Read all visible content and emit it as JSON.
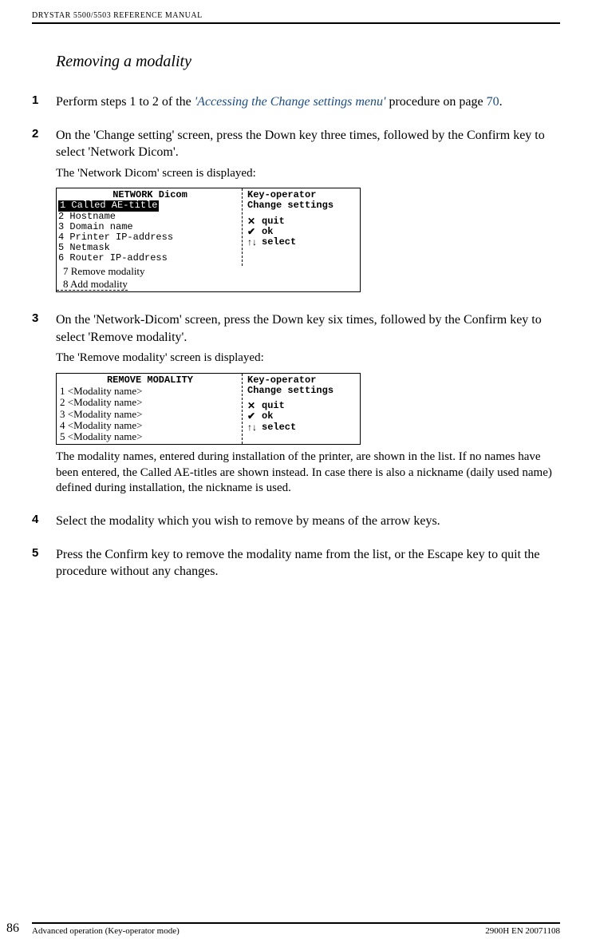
{
  "header": {
    "running": "DRYSTAR 5500/5503 REFERENCE MANUAL"
  },
  "title": "Removing a modality",
  "steps": {
    "s1": {
      "num": "1",
      "pre": "Perform steps 1 to 2 of the ",
      "link": "'Accessing the Change settings menu'",
      "mid": " procedure on page ",
      "pagenum": "70",
      "post": "."
    },
    "s2": {
      "num": "2",
      "text": "On the 'Change setting' screen, press the Down key three times, followed by the Confirm key to select 'Network Dicom'.",
      "sub": "The 'Network Dicom' screen is displayed:"
    },
    "s3": {
      "num": "3",
      "text": "On the 'Network-Dicom' screen, press the Down key six times, followed by the Confirm key to select 'Remove modality'.",
      "sub": "The 'Remove modality' screen is displayed:",
      "note": "The modality names, entered during installation of the printer, are shown in the list. If no names have been entered, the Called AE-titles are shown instead. In case there is also a nickname (daily used name) defined during installation, the nickname is used."
    },
    "s4": {
      "num": "4",
      "text": "Select the modality which you wish to remove by means of the arrow keys."
    },
    "s5": {
      "num": "5",
      "text": "Press the Confirm key to remove the modality name from the list, or the Escape key to quit the procedure without any changes."
    }
  },
  "screen1": {
    "title": "NETWORK Dicom",
    "items": {
      "i1": "1 Called AE-title",
      "i2": "2 Hostname",
      "i3": "3 Domain name",
      "i4": "4 Printer IP-address",
      "i5": "5 Netmask",
      "i6": "6 Router IP-address"
    },
    "extra7": "7 Remove modality",
    "extra8": "8 Add modality",
    "right": {
      "l1": "Key-operator",
      "l2": "Change settings",
      "quit": "quit",
      "ok": "ok",
      "select": "select"
    }
  },
  "screen2": {
    "title": "REMOVE MODALITY",
    "items": {
      "i1": "1 <Modality name>",
      "i2": "2 <Modality name>",
      "i3": "3 <Modality name>",
      "i4": "4 <Modality name>",
      "i5": "5 <Modality name>"
    },
    "right": {
      "l1": "Key-operator",
      "l2": "Change settings",
      "quit": "quit",
      "ok": "ok",
      "select": "select"
    }
  },
  "footer": {
    "left": "Advanced operation (Key-operator mode)",
    "right": "2900H EN 20071108",
    "pagenum": "86"
  }
}
